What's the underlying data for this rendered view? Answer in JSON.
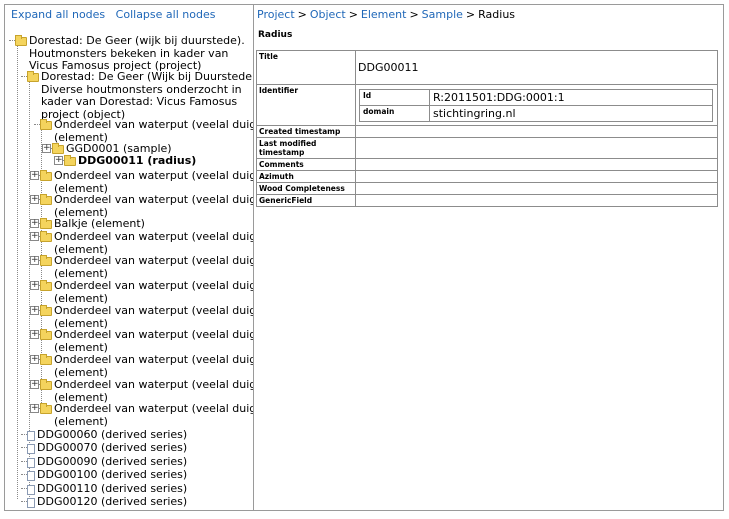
{
  "tree_controls": {
    "expand_all": "Expand all nodes",
    "collapse_all": "Collapse all nodes"
  },
  "tree": [
    {
      "label": "Dorestad: De Geer (wijk bij duurstede). Houtmonsters bekeken in kader van Vicus Famosus project (project)",
      "lines": [
        "Dorestad: De Geer (wijk bij duurstede).",
        "Houtmonsters bekeken in kader van",
        "Vicus Famosus project (project)"
      ]
    },
    {
      "label": "Dorestad: De Geer (Wijk bij Duurstede) Diverse houtmonsters onderzocht in kader van Dorestad: Vicus Famosus project (object)",
      "lines": [
        "Dorestad: De Geer (Wijk bij Duurstede)",
        "Diverse houtmonsters onderzocht in",
        "kader van Dorestad: Vicus Famosus",
        "project (object)"
      ]
    },
    {
      "lines": [
        "Onderdeel van waterput (veelal duig)",
        "(element)"
      ]
    },
    {
      "lines": [
        "GGD0001 (sample)"
      ]
    },
    {
      "lines": [
        "DDG00011 (radius)"
      ]
    },
    {
      "lines": [
        "Onderdeel van waterput (veelal duig)",
        "(element)"
      ]
    },
    {
      "lines": [
        "Onderdeel van waterput (veelal duig)",
        "(element)"
      ]
    },
    {
      "lines": [
        "Balkje (element)"
      ]
    },
    {
      "lines": [
        "Onderdeel van waterput (veelal duig)",
        "(element)"
      ]
    },
    {
      "lines": [
        "Onderdeel van waterput (veelal duig)",
        "(element)"
      ]
    },
    {
      "lines": [
        "Onderdeel van waterput (veelal duig)",
        "(element)"
      ]
    },
    {
      "lines": [
        "Onderdeel van waterput (veelal duig)",
        "(element)"
      ]
    },
    {
      "lines": [
        "Onderdeel van waterput (veelal duig)",
        "(element)"
      ]
    },
    {
      "lines": [
        "Onderdeel van waterput (veelal duig)",
        "(element)"
      ]
    },
    {
      "lines": [
        "Onderdeel van waterput (veelal duig)",
        "(element)"
      ]
    },
    {
      "lines": [
        "Onderdeel van waterput (veelal duig)",
        "(element)"
      ]
    },
    {
      "lines": [
        "DDG00060 (derived series)"
      ]
    },
    {
      "lines": [
        "DDG00070 (derived series)"
      ]
    },
    {
      "lines": [
        "DDG00090 (derived series)"
      ]
    },
    {
      "lines": [
        "DDG00100 (derived series)"
      ]
    },
    {
      "lines": [
        "DDG00110 (derived series)"
      ]
    },
    {
      "lines": [
        "DDG00120 (derived series)"
      ]
    }
  ],
  "breadcrumb": [
    "Project",
    "Object",
    "Element",
    "Sample"
  ],
  "breadcrumb_current": "Radius",
  "breadcrumb_sep": ">",
  "page_title": "Radius",
  "props": {
    "title_label": "Title",
    "title_value": "DDG00011",
    "identifier_label": "Identifier",
    "id_label": "Id",
    "id_value": "R:2011501:DDG:0001:1",
    "domain_label": "domain",
    "domain_value": "stichtingring.nl",
    "created_label": "Created timestamp",
    "modified_label": "Last modified timestamp",
    "comments_label": "Comments",
    "azimuth_label": "Azimuth",
    "wood_label": "Wood Completeness",
    "generic_label": "GenericField"
  }
}
